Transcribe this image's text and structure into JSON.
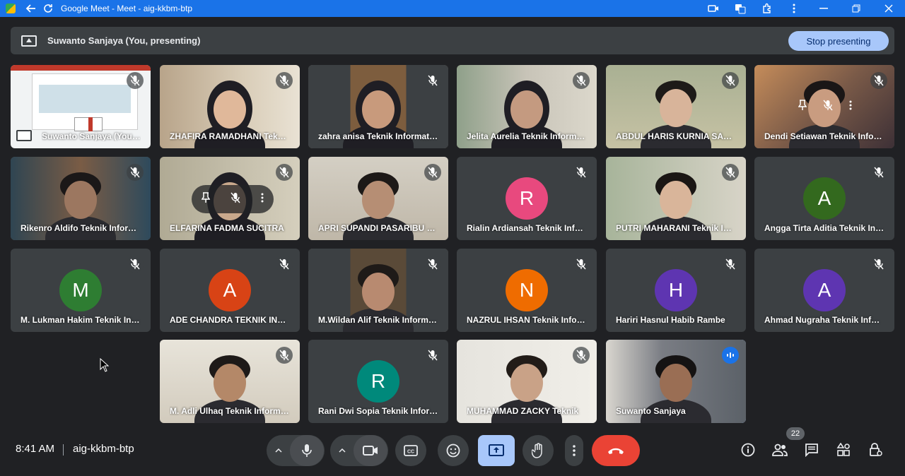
{
  "window": {
    "title": "Google Meet - Meet - aig-kkbm-btp",
    "theme_color": "#1a73e8"
  },
  "presenting_bar": {
    "label": "Suwanto Sanjaya (You, presenting)",
    "stop_button": "Stop presenting"
  },
  "participants": [
    {
      "name": "Suwanto Sanjaya (You, presenting)",
      "type": "screen"
    },
    {
      "name": "ZHAFIRA RAMADHANI Teknik Informatika",
      "type": "video"
    },
    {
      "name": "zahra anisa Teknik Informatika",
      "type": "video"
    },
    {
      "name": "Jelita Aurelia Teknik Informatika",
      "type": "video"
    },
    {
      "name": "ABDUL HARIS KURNIA SAPUTRA",
      "type": "video"
    },
    {
      "name": "Dendi Setiawan Teknik Informatika",
      "type": "video"
    },
    {
      "name": "Rikenro Aldifo Teknik Informatika",
      "type": "video"
    },
    {
      "name": "ELFARINA FADMA SUCITRA",
      "type": "video"
    },
    {
      "name": "APRI SUPANDI PASARIBU Teknik",
      "type": "video"
    },
    {
      "name": "Rialin Ardiansah Teknik Informatika",
      "type": "avatar",
      "initial": "R",
      "color": "#e8497e"
    },
    {
      "name": "PUTRI MAHARANI Teknik Informatika",
      "type": "video"
    },
    {
      "name": "Angga Tirta Aditia Teknik Informatika",
      "type": "avatar",
      "initial": "A",
      "color": "#33691e"
    },
    {
      "name": "M. Lukman Hakim Teknik Informatika",
      "type": "avatar",
      "initial": "M",
      "color": "#2e7d32"
    },
    {
      "name": "ADE CHANDRA TEKNIK INFORMATIKA",
      "type": "avatar",
      "initial": "A",
      "color": "#d84315"
    },
    {
      "name": "M.Wildan Alif Teknik Informatika",
      "type": "video"
    },
    {
      "name": "NAZRUL IHSAN Teknik Informatika",
      "type": "avatar",
      "initial": "N",
      "color": "#ef6c00"
    },
    {
      "name": "Hariri Hasnul Habib Rambe",
      "type": "avatar",
      "initial": "H",
      "color": "#5e35b1"
    },
    {
      "name": "Ahmad Nugraha Teknik Informatika",
      "type": "avatar",
      "initial": "A",
      "color": "#5e35b1"
    },
    {
      "name": "M. Adli Ulhaq Teknik Informatika",
      "type": "video"
    },
    {
      "name": "Rani Dwi Sopia Teknik Informatika",
      "type": "avatar",
      "initial": "R",
      "color": "#00897b"
    },
    {
      "name": "MUHAMMAD ZACKY Teknik",
      "type": "video"
    },
    {
      "name": "Suwanto Sanjaya",
      "type": "video"
    }
  ],
  "bottom_bar": {
    "time": "8:41 AM",
    "meeting_code": "aig-kkbm-btp",
    "people_count": "22"
  }
}
